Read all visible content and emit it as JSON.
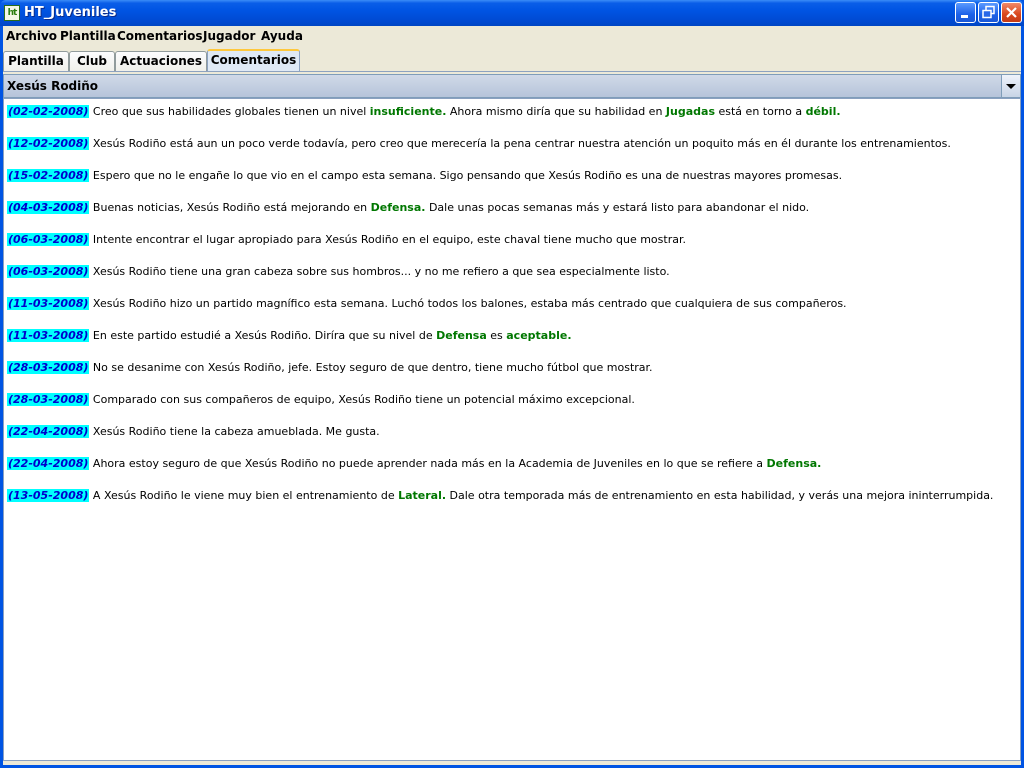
{
  "window": {
    "title": "HT_Juveniles",
    "icon_text": "ht"
  },
  "menu": [
    "Archivo",
    "Plantilla",
    "Comentarios",
    "Jugador",
    "Ayuda"
  ],
  "tabs": [
    "Plantilla",
    "Club",
    "Actuaciones",
    "Comentarios"
  ],
  "active_tab": "Comentarios",
  "player_selector": {
    "selected": "Xesús Rodiño"
  },
  "comments": [
    {
      "date": "(02-02-2008)",
      "parts": [
        {
          "t": "Creo que sus habilidades globales tienen un nivel "
        },
        {
          "t": "insuficiente.",
          "hl": true
        },
        {
          "t": " Ahora mismo diría que su habilidad en "
        },
        {
          "t": "Jugadas",
          "hl": true
        },
        {
          "t": " está en torno a "
        },
        {
          "t": "débil.",
          "hl": true
        }
      ]
    },
    {
      "date": "(12-02-2008)",
      "parts": [
        {
          "t": "Xesús Rodiño está aun un poco verde todavía, pero creo que merecería la pena centrar nuestra atención un poquito más en él durante los entrenamientos."
        }
      ]
    },
    {
      "date": "(15-02-2008)",
      "parts": [
        {
          "t": "Espero que no le engañe lo que vio en el campo esta semana. Sigo pensando que Xesús Rodiño es una de nuestras mayores promesas."
        }
      ]
    },
    {
      "date": "(04-03-2008)",
      "parts": [
        {
          "t": "Buenas noticias, Xesús Rodiño está mejorando en "
        },
        {
          "t": "Defensa.",
          "hl": true
        },
        {
          "t": " Dale unas pocas semanas más y estará listo para abandonar el nido."
        }
      ]
    },
    {
      "date": "(06-03-2008)",
      "parts": [
        {
          "t": "Intente encontrar el lugar apropiado para Xesús Rodiño en el equipo, este chaval tiene mucho que mostrar."
        }
      ]
    },
    {
      "date": "(06-03-2008)",
      "parts": [
        {
          "t": "Xesús Rodiño tiene una gran cabeza sobre sus hombros... y no me refiero a que sea especialmente listo."
        }
      ]
    },
    {
      "date": "(11-03-2008)",
      "parts": [
        {
          "t": "Xesús Rodiño hizo un partido magnífico esta semana. Luchó todos los balones, estaba más centrado que cualquiera de sus compañeros."
        }
      ]
    },
    {
      "date": "(11-03-2008)",
      "parts": [
        {
          "t": "En este partido estudié a Xesús Rodiño. Diríra que su nivel de "
        },
        {
          "t": "Defensa",
          "hl": true
        },
        {
          "t": " es "
        },
        {
          "t": "aceptable.",
          "hl": true
        }
      ]
    },
    {
      "date": "(28-03-2008)",
      "parts": [
        {
          "t": "No se desanime con Xesús Rodiño, jefe. Estoy seguro de que dentro, tiene mucho fútbol que mostrar."
        }
      ]
    },
    {
      "date": "(28-03-2008)",
      "parts": [
        {
          "t": "Comparado con sus compañeros de equipo, Xesús Rodiño tiene un potencial máximo excepcional."
        }
      ]
    },
    {
      "date": "(22-04-2008)",
      "parts": [
        {
          "t": "Xesús Rodiño tiene la cabeza amueblada. Me gusta."
        }
      ]
    },
    {
      "date": "(22-04-2008)",
      "parts": [
        {
          "t": "Ahora estoy seguro de que Xesús Rodiño no puede aprender nada más en la Academia de Juveniles en lo que se refiere a "
        },
        {
          "t": "Defensa.",
          "hl": true
        }
      ]
    },
    {
      "date": "(13-05-2008)",
      "parts": [
        {
          "t": "A Xesús Rodiño le viene muy bien el entrenamiento de "
        },
        {
          "t": "Lateral.",
          "hl": true
        },
        {
          "t": " Dale otra temporada más de entrenamiento en esta habilidad, y verás una mejora ininterrumpida."
        }
      ]
    }
  ],
  "colors": {
    "date_bg": "#00ffff",
    "date_text": "#0000cc",
    "highlight": "#007700",
    "titlebar": "#0054e3"
  },
  "icons": {
    "minimize": "minimize-icon",
    "maximize": "restore-icon",
    "close": "close-icon",
    "dropdown": "chevron-down-icon"
  }
}
